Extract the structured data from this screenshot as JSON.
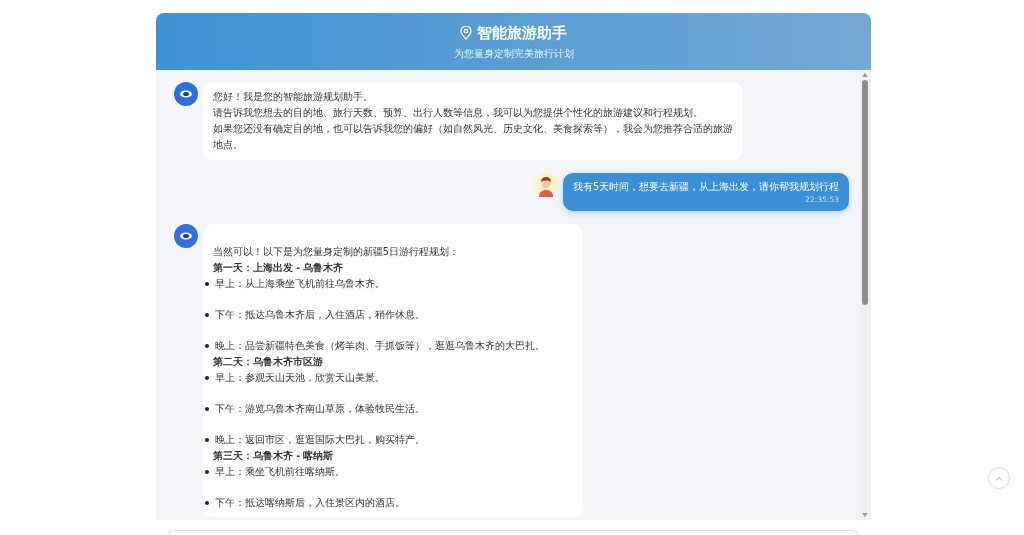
{
  "header": {
    "title": "智能旅游助手",
    "subtitle": "为您量身定制完美旅行计划"
  },
  "messages": [
    {
      "kind": "bot",
      "lines": [
        "您好！我是您的智能旅游规划助手。",
        "请告诉我您想去的目的地、旅行天数、预算、出行人数等信息，我可以为您提供个性化的旅游建议和行程规划。",
        "如果您还没有确定目的地，也可以告诉我您的偏好（如自然风光、历史文化、美食探索等），我会为您推荐合适的旅游地点。"
      ]
    },
    {
      "kind": "user",
      "text": "我有5天时间，想要去新疆，从上海出发，请你帮我规划行程",
      "time": "22:35:53"
    },
    {
      "kind": "bot",
      "intro": "当然可以！以下是为您量身定制的新疆5日游行程规划：",
      "days": [
        {
          "title": "第一天：上海出发 - 乌鲁木齐",
          "items": [
            "早上：从上海乘坐飞机前往乌鲁木齐。",
            "下午：抵达乌鲁木齐后，入住酒店，稍作休息。",
            "晚上：品尝新疆特色美食（烤羊肉、手抓饭等），逛逛乌鲁木齐的大巴扎。"
          ]
        },
        {
          "title": "第二天：乌鲁木齐市区游",
          "items": [
            "早上：参观天山天池，欣赏天山美景。",
            "下午：游览乌鲁木齐南山草原，体验牧民生活。",
            "晚上：返回市区，逛逛国际大巴扎，购买特产。"
          ]
        },
        {
          "title": "第三天：乌鲁木齐 - 喀纳斯",
          "items": [
            "早上：乘坐飞机前往喀纳斯。",
            "下午：抵达喀纳斯后，入住景区内的酒店。"
          ]
        }
      ]
    }
  ]
}
